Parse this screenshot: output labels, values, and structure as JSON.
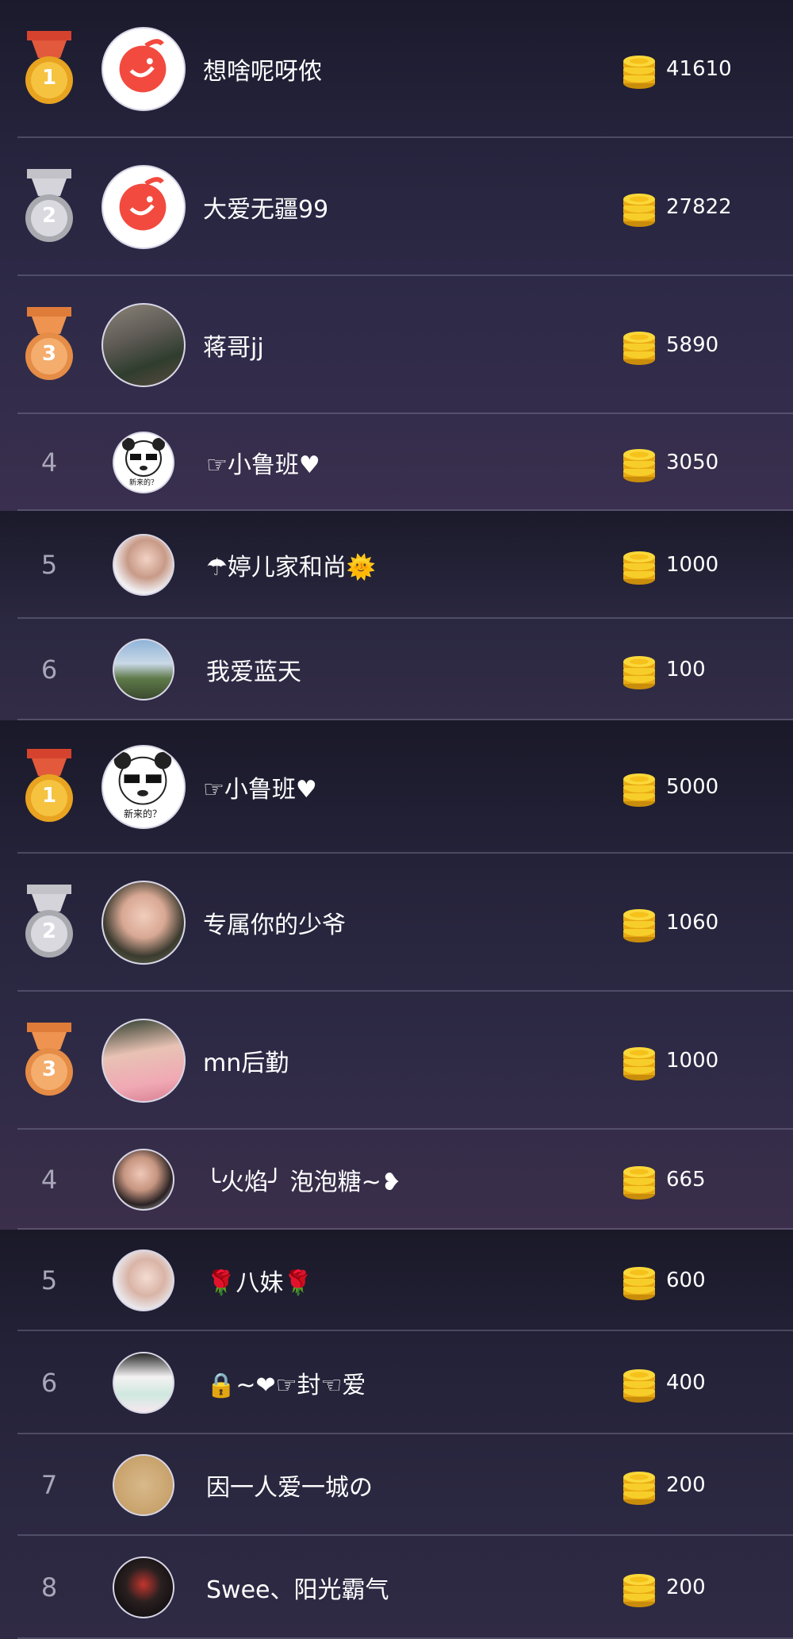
{
  "section1": {
    "ranks": [
      {
        "rank": "1",
        "medal": "gold",
        "name": "想啥呢呀侬",
        "score": "41610",
        "avatar": "app-logo"
      },
      {
        "rank": "2",
        "medal": "silver",
        "name": "大爱无疆99",
        "score": "27822",
        "avatar": "app-logo"
      },
      {
        "rank": "3",
        "medal": "bronze",
        "name": "蒋哥jj",
        "score": "5890",
        "avatar": "photo-room"
      },
      {
        "rank": "4",
        "name": "☞小鲁班♥",
        "score": "3050",
        "avatar": "panda-meme"
      },
      {
        "rank": "5",
        "name": "☂婷儿家和尚🌞",
        "score": "1000",
        "avatar": "photo-girl"
      },
      {
        "rank": "6",
        "name": "我爱蓝天",
        "score": "100",
        "avatar": "photo-landscape"
      }
    ]
  },
  "section2": {
    "ranks": [
      {
        "rank": "1",
        "medal": "gold",
        "name": "☞小鲁班♥",
        "score": "5000",
        "avatar": "panda-meme"
      },
      {
        "rank": "2",
        "medal": "silver",
        "name": "专属你的少爷",
        "score": "1060",
        "avatar": "photo-girl"
      },
      {
        "rank": "3",
        "medal": "bronze",
        "name": "mn后勤",
        "score": "1000",
        "avatar": "photo-girl"
      },
      {
        "rank": "4",
        "name": "╰火焰╯ 泡泡糖~❥",
        "score": "665",
        "avatar": "photo-girl"
      },
      {
        "rank": "5",
        "name": "🌹八妹🌹",
        "score": "600",
        "avatar": "photo-girl"
      },
      {
        "rank": "6",
        "name": "🔒~❤☞封☜爱",
        "score": "400",
        "avatar": "photo-couple"
      },
      {
        "rank": "7",
        "name": "因一人爱一城の",
        "score": "200",
        "avatar": "photo-text"
      },
      {
        "rank": "8",
        "name": "Swee、阳光霸气",
        "score": "200",
        "avatar": "photo-dark"
      }
    ]
  },
  "avatar_panda_text": "新来的？",
  "colors": {
    "gold": "#f2b531",
    "silver": "#c9c9cf",
    "bronze": "#eb9a4e",
    "coin": "#f5c51c",
    "logo_red": "#f24a3f"
  }
}
